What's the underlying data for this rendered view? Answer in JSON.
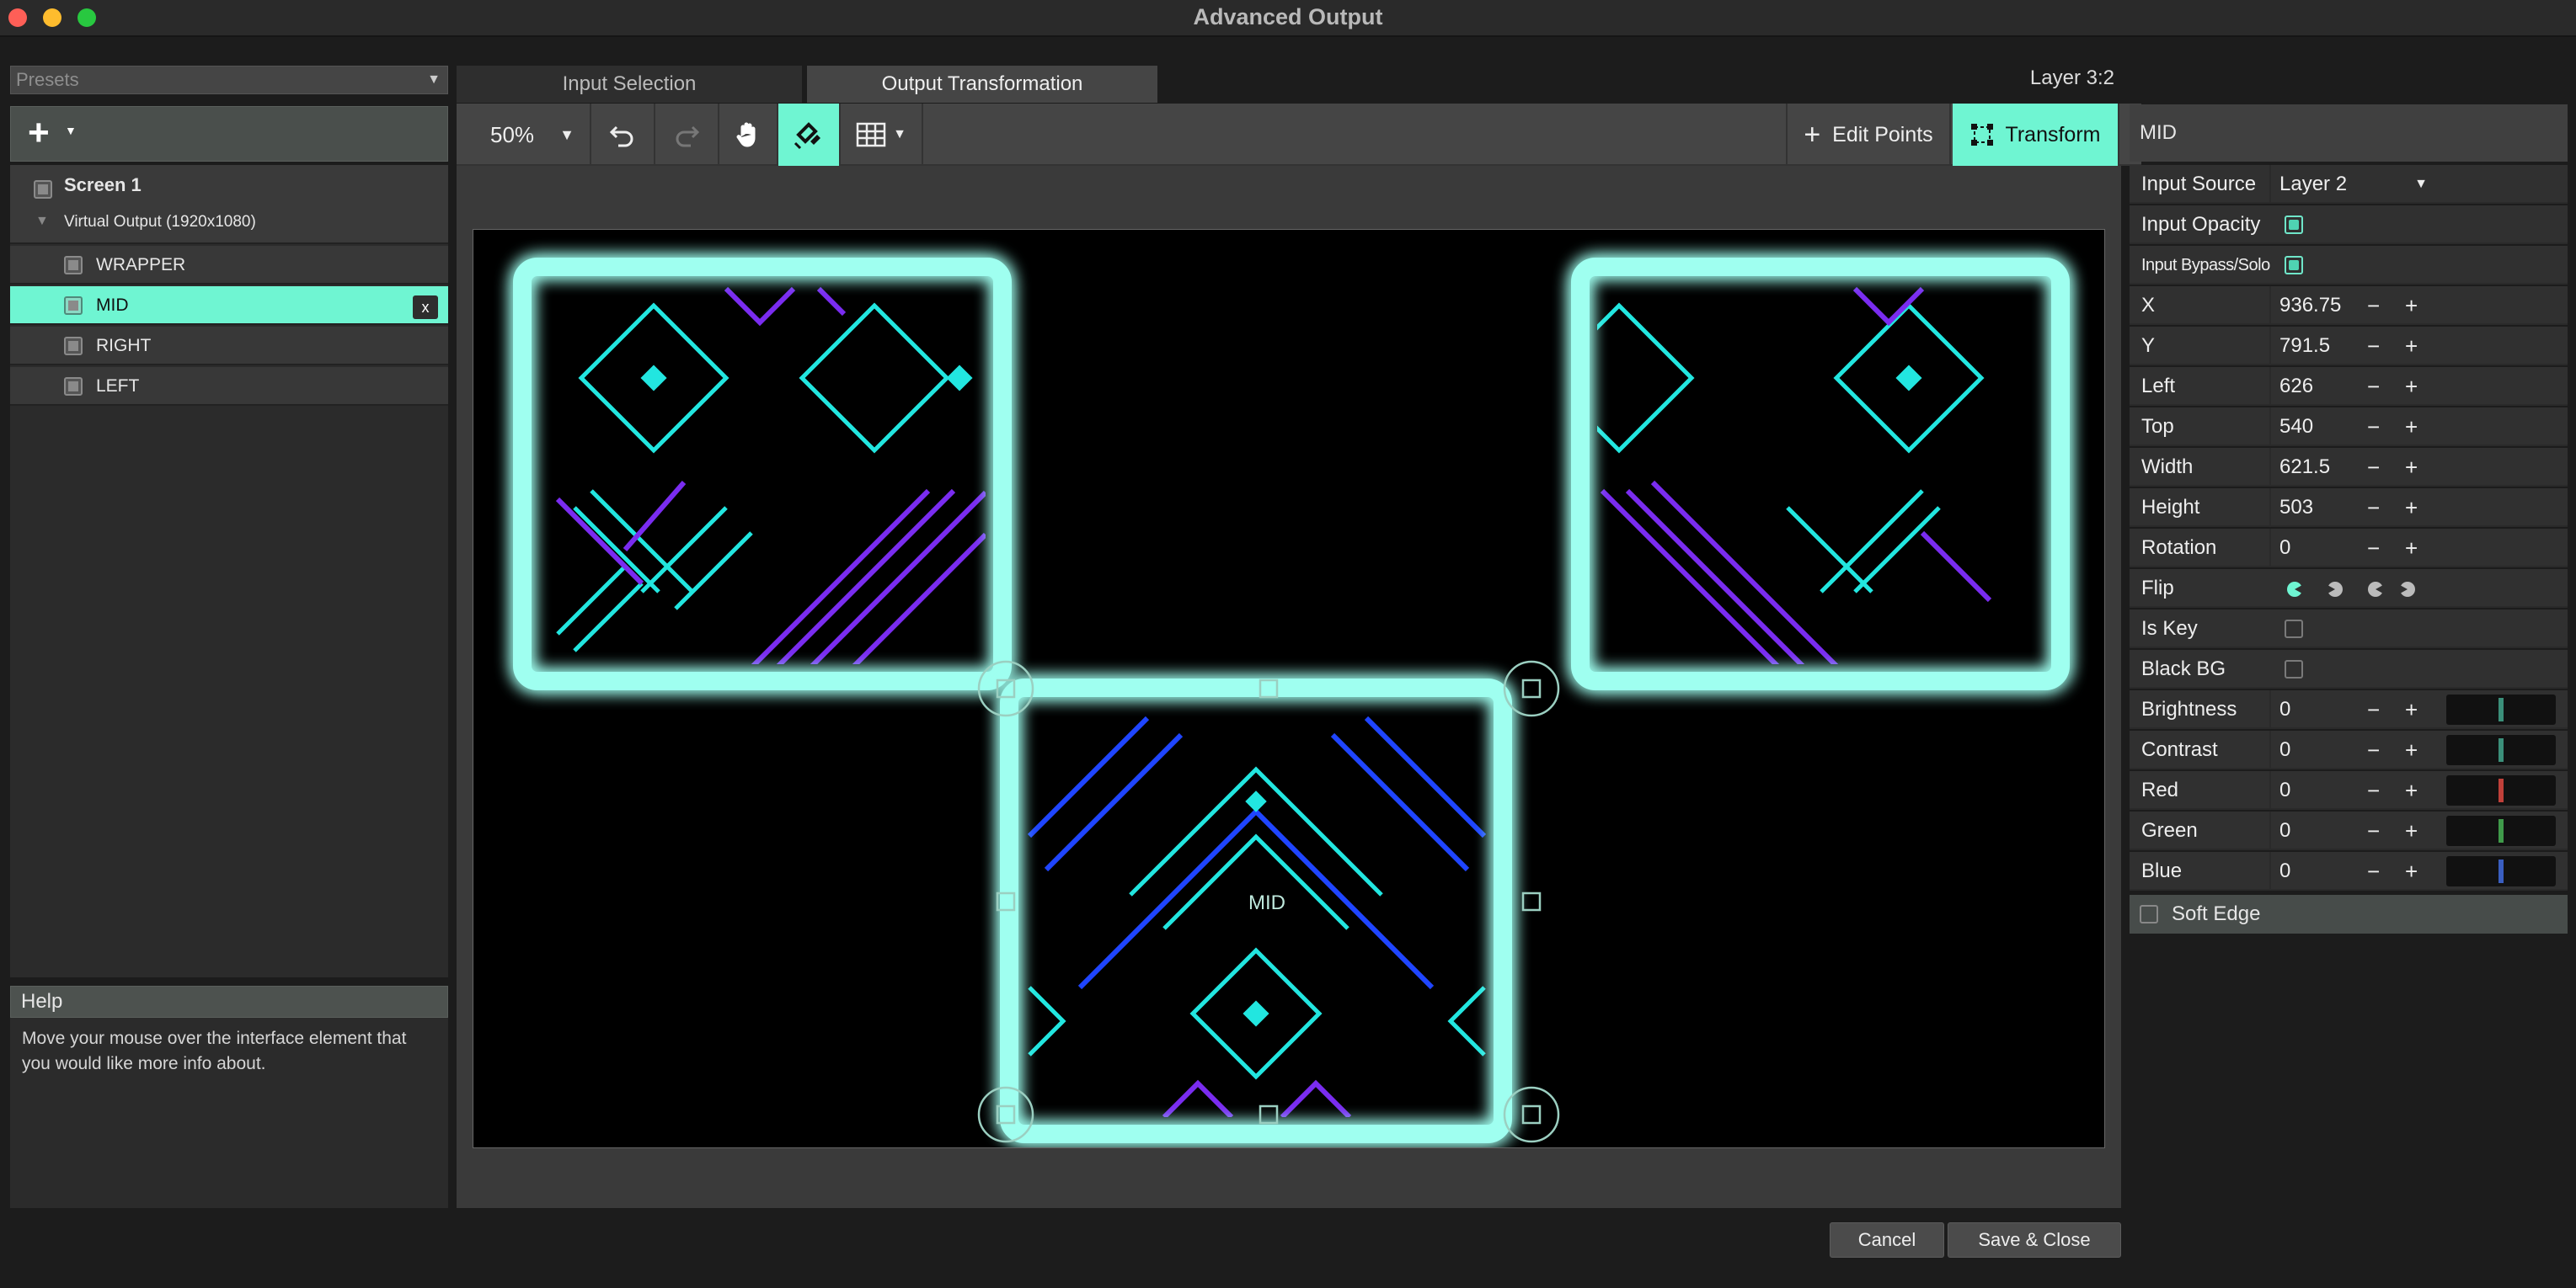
{
  "window": {
    "title": "Advanced Output"
  },
  "presets": {
    "label": "Presets"
  },
  "tree": {
    "screen": "Screen 1",
    "virtual_output": "Virtual Output (1920x1080)",
    "slices": [
      {
        "label": "WRAPPER"
      },
      {
        "label": "MID"
      },
      {
        "label": "RIGHT"
      },
      {
        "label": "LEFT"
      }
    ],
    "delete_label": "x"
  },
  "help": {
    "title": "Help",
    "text": "Move your mouse over the interface element that you would like more info about."
  },
  "tabs": [
    {
      "label": "Input Selection"
    },
    {
      "label": "Output Transformation"
    }
  ],
  "layer_label": "Layer 3:2",
  "toolbar": {
    "zoom": "50%",
    "edit_points": "Edit Points",
    "transform": "Transform"
  },
  "canvas": {
    "selected_label": "MID"
  },
  "buttons": {
    "cancel": "Cancel",
    "save_close": "Save & Close"
  },
  "properties": {
    "header": "MID",
    "input_source_label": "Input Source",
    "input_source_value": "Layer 2",
    "input_opacity_label": "Input Opacity",
    "input_bypass_label": "Input Bypass/Solo",
    "x_label": "X",
    "x": "936.75",
    "y_label": "Y",
    "y": "791.5",
    "left_label": "Left",
    "left": "626",
    "top_label": "Top",
    "top": "540",
    "width_label": "Width",
    "width": "621.5",
    "height_label": "Height",
    "height": "503",
    "rotation_label": "Rotation",
    "rotation": "0",
    "flip_label": "Flip",
    "is_key_label": "Is Key",
    "black_bg_label": "Black BG",
    "brightness_label": "Brightness",
    "brightness": "0",
    "contrast_label": "Contrast",
    "contrast": "0",
    "red_label": "Red",
    "red": "0",
    "green_label": "Green",
    "green": "0",
    "blue_label": "Blue",
    "blue": "0",
    "soft_edge_label": "Soft Edge",
    "minus": "−",
    "plus": "+"
  },
  "colors": {
    "accent": "#6ff5d2",
    "red_slider": "#c0403a",
    "green_slider": "#3f9a4a",
    "blue_slider": "#3a5ec0",
    "neutral_slider": "#3b8f7a"
  }
}
